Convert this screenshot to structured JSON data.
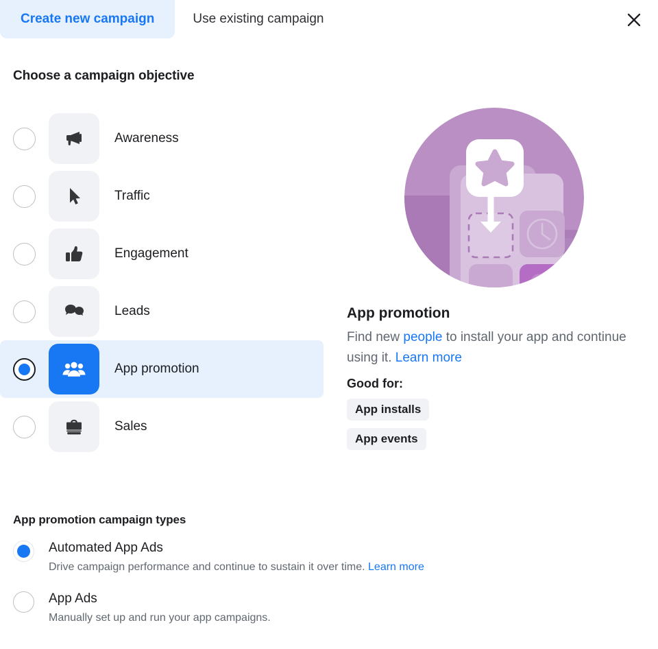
{
  "tabs": [
    {
      "label": "Create new campaign",
      "active": true,
      "name": "tab-create-new-campaign"
    },
    {
      "label": "Use existing campaign",
      "active": false,
      "name": "tab-use-existing-campaign"
    }
  ],
  "close_label": "✕",
  "objective_section": {
    "heading": "Choose a campaign objective",
    "items": [
      {
        "label": "Awareness",
        "icon": "megaphone-icon",
        "selected": false
      },
      {
        "label": "Traffic",
        "icon": "cursor-icon",
        "selected": false
      },
      {
        "label": "Engagement",
        "icon": "thumbs-up-icon",
        "selected": false
      },
      {
        "label": "Leads",
        "icon": "speech-bubbles-icon",
        "selected": false
      },
      {
        "label": "App promotion",
        "icon": "people-group-icon",
        "selected": true
      },
      {
        "label": "Sales",
        "icon": "briefcase-icon",
        "selected": false
      }
    ]
  },
  "detail": {
    "illustration": "app-install-illustration",
    "title": "App promotion",
    "desc_part1": "Find new ",
    "desc_link1": "people",
    "desc_part2": " to install your app and continue using it. ",
    "desc_link2": "Learn more",
    "good_for_label": "Good for:",
    "chips": [
      "App installs",
      "App events"
    ]
  },
  "campaign_types": {
    "heading": "App promotion campaign types",
    "items": [
      {
        "title": "Automated App Ads",
        "desc": "Drive campaign performance and continue to sustain it over time. ",
        "link": "Learn more",
        "selected": true
      },
      {
        "title": "App Ads",
        "desc": "Manually set up and run your app campaigns.",
        "link": "",
        "selected": false
      }
    ]
  },
  "colors": {
    "accent_blue": "#1877f2",
    "tab_active_bg": "#e7f0fd",
    "tile_bg": "#f0f2f5",
    "text_primary": "#1c1e21",
    "text_secondary": "#606770",
    "illustration_purple": "#b98fc4"
  }
}
